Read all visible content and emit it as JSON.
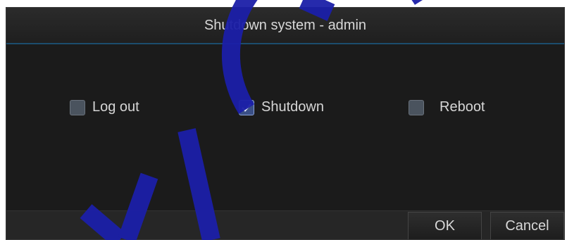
{
  "dialog": {
    "title": "Shutdown system - admin",
    "options": [
      {
        "label": "Log out",
        "checked": false
      },
      {
        "label": "Shutdown",
        "checked": true
      },
      {
        "label": "Reboot",
        "checked": false
      }
    ],
    "ok_label": "OK",
    "cancel_label": "Cancel"
  },
  "colors": {
    "background": "#1b1b1b",
    "title_separator": "#1c4d6e",
    "checkbox_checked": "#3a4f86",
    "watermark": "#1b1fa8"
  }
}
